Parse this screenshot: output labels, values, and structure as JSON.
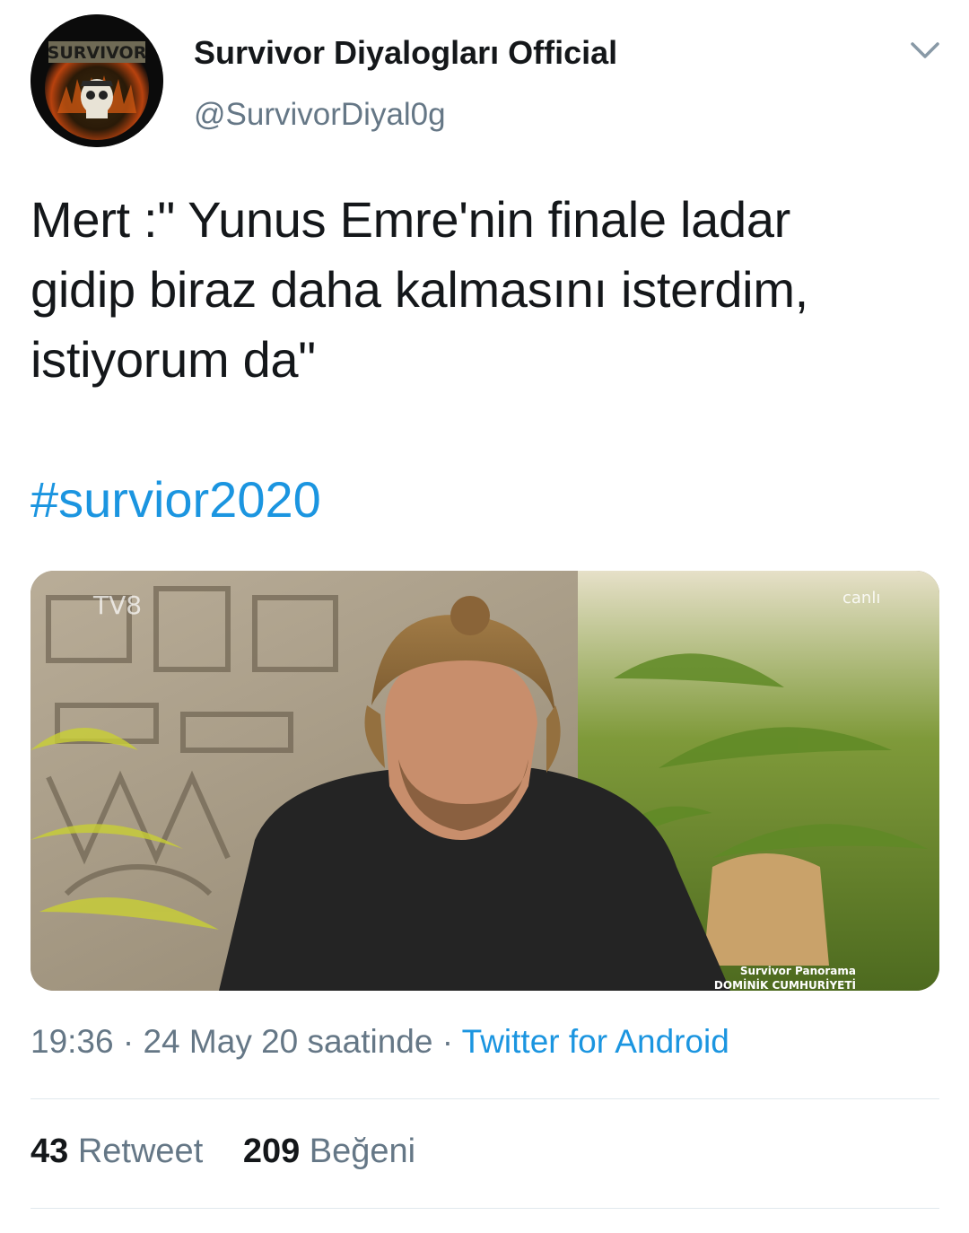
{
  "tweet": {
    "author": {
      "display_name": "Survivor Diyalogları Official",
      "handle": "@SurvivorDiyal0g",
      "avatar_text": "SURVIVOR"
    },
    "text_lines": [
      "Mert :\" Yunus Emre'nin finale ladar",
      "gidip biraz daha kalmasını isterdim,",
      "istiyorum da\""
    ],
    "hashtag": "#survior2020",
    "media": {
      "channel_logo": "TV8",
      "live_label": "canlı",
      "show_title": "Survivor Panorama",
      "location": "DOMİNİK CUMHURİYETİ"
    },
    "meta": {
      "time": "19:36",
      "separator": "·",
      "date": "24 May 20 saatinde",
      "source": "Twitter for Android"
    },
    "stats": {
      "retweets": "43",
      "retweets_label": "Retweet",
      "likes": "209",
      "likes_label": "Beğeni"
    }
  },
  "colors": {
    "text": "#14171a",
    "secondary": "#657786",
    "link": "#1b95e0",
    "divider": "#e1e8ed"
  },
  "icons": {
    "menu": "chevron-down-icon"
  }
}
